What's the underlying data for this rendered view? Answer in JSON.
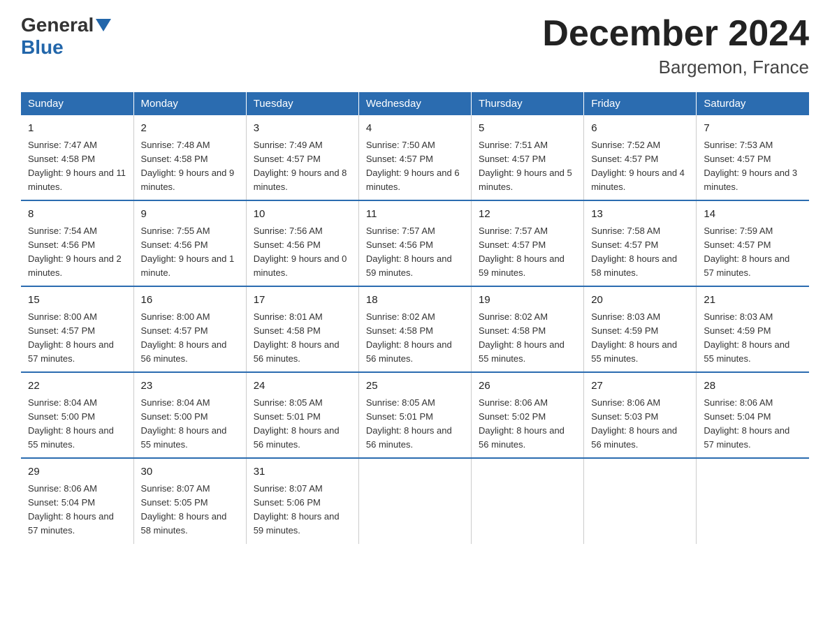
{
  "header": {
    "logo_general": "General",
    "logo_blue": "Blue",
    "title": "December 2024",
    "subtitle": "Bargemon, France"
  },
  "days_of_week": [
    "Sunday",
    "Monday",
    "Tuesday",
    "Wednesday",
    "Thursday",
    "Friday",
    "Saturday"
  ],
  "weeks": [
    [
      {
        "day": "1",
        "sunrise": "7:47 AM",
        "sunset": "4:58 PM",
        "daylight": "9 hours and 11 minutes."
      },
      {
        "day": "2",
        "sunrise": "7:48 AM",
        "sunset": "4:58 PM",
        "daylight": "9 hours and 9 minutes."
      },
      {
        "day": "3",
        "sunrise": "7:49 AM",
        "sunset": "4:57 PM",
        "daylight": "9 hours and 8 minutes."
      },
      {
        "day": "4",
        "sunrise": "7:50 AM",
        "sunset": "4:57 PM",
        "daylight": "9 hours and 6 minutes."
      },
      {
        "day": "5",
        "sunrise": "7:51 AM",
        "sunset": "4:57 PM",
        "daylight": "9 hours and 5 minutes."
      },
      {
        "day": "6",
        "sunrise": "7:52 AM",
        "sunset": "4:57 PM",
        "daylight": "9 hours and 4 minutes."
      },
      {
        "day": "7",
        "sunrise": "7:53 AM",
        "sunset": "4:57 PM",
        "daylight": "9 hours and 3 minutes."
      }
    ],
    [
      {
        "day": "8",
        "sunrise": "7:54 AM",
        "sunset": "4:56 PM",
        "daylight": "9 hours and 2 minutes."
      },
      {
        "day": "9",
        "sunrise": "7:55 AM",
        "sunset": "4:56 PM",
        "daylight": "9 hours and 1 minute."
      },
      {
        "day": "10",
        "sunrise": "7:56 AM",
        "sunset": "4:56 PM",
        "daylight": "9 hours and 0 minutes."
      },
      {
        "day": "11",
        "sunrise": "7:57 AM",
        "sunset": "4:56 PM",
        "daylight": "8 hours and 59 minutes."
      },
      {
        "day": "12",
        "sunrise": "7:57 AM",
        "sunset": "4:57 PM",
        "daylight": "8 hours and 59 minutes."
      },
      {
        "day": "13",
        "sunrise": "7:58 AM",
        "sunset": "4:57 PM",
        "daylight": "8 hours and 58 minutes."
      },
      {
        "day": "14",
        "sunrise": "7:59 AM",
        "sunset": "4:57 PM",
        "daylight": "8 hours and 57 minutes."
      }
    ],
    [
      {
        "day": "15",
        "sunrise": "8:00 AM",
        "sunset": "4:57 PM",
        "daylight": "8 hours and 57 minutes."
      },
      {
        "day": "16",
        "sunrise": "8:00 AM",
        "sunset": "4:57 PM",
        "daylight": "8 hours and 56 minutes."
      },
      {
        "day": "17",
        "sunrise": "8:01 AM",
        "sunset": "4:58 PM",
        "daylight": "8 hours and 56 minutes."
      },
      {
        "day": "18",
        "sunrise": "8:02 AM",
        "sunset": "4:58 PM",
        "daylight": "8 hours and 56 minutes."
      },
      {
        "day": "19",
        "sunrise": "8:02 AM",
        "sunset": "4:58 PM",
        "daylight": "8 hours and 55 minutes."
      },
      {
        "day": "20",
        "sunrise": "8:03 AM",
        "sunset": "4:59 PM",
        "daylight": "8 hours and 55 minutes."
      },
      {
        "day": "21",
        "sunrise": "8:03 AM",
        "sunset": "4:59 PM",
        "daylight": "8 hours and 55 minutes."
      }
    ],
    [
      {
        "day": "22",
        "sunrise": "8:04 AM",
        "sunset": "5:00 PM",
        "daylight": "8 hours and 55 minutes."
      },
      {
        "day": "23",
        "sunrise": "8:04 AM",
        "sunset": "5:00 PM",
        "daylight": "8 hours and 55 minutes."
      },
      {
        "day": "24",
        "sunrise": "8:05 AM",
        "sunset": "5:01 PM",
        "daylight": "8 hours and 56 minutes."
      },
      {
        "day": "25",
        "sunrise": "8:05 AM",
        "sunset": "5:01 PM",
        "daylight": "8 hours and 56 minutes."
      },
      {
        "day": "26",
        "sunrise": "8:06 AM",
        "sunset": "5:02 PM",
        "daylight": "8 hours and 56 minutes."
      },
      {
        "day": "27",
        "sunrise": "8:06 AM",
        "sunset": "5:03 PM",
        "daylight": "8 hours and 56 minutes."
      },
      {
        "day": "28",
        "sunrise": "8:06 AM",
        "sunset": "5:04 PM",
        "daylight": "8 hours and 57 minutes."
      }
    ],
    [
      {
        "day": "29",
        "sunrise": "8:06 AM",
        "sunset": "5:04 PM",
        "daylight": "8 hours and 57 minutes."
      },
      {
        "day": "30",
        "sunrise": "8:07 AM",
        "sunset": "5:05 PM",
        "daylight": "8 hours and 58 minutes."
      },
      {
        "day": "31",
        "sunrise": "8:07 AM",
        "sunset": "5:06 PM",
        "daylight": "8 hours and 59 minutes."
      },
      null,
      null,
      null,
      null
    ]
  ],
  "labels": {
    "sunrise": "Sunrise:",
    "sunset": "Sunset:",
    "daylight": "Daylight:"
  }
}
